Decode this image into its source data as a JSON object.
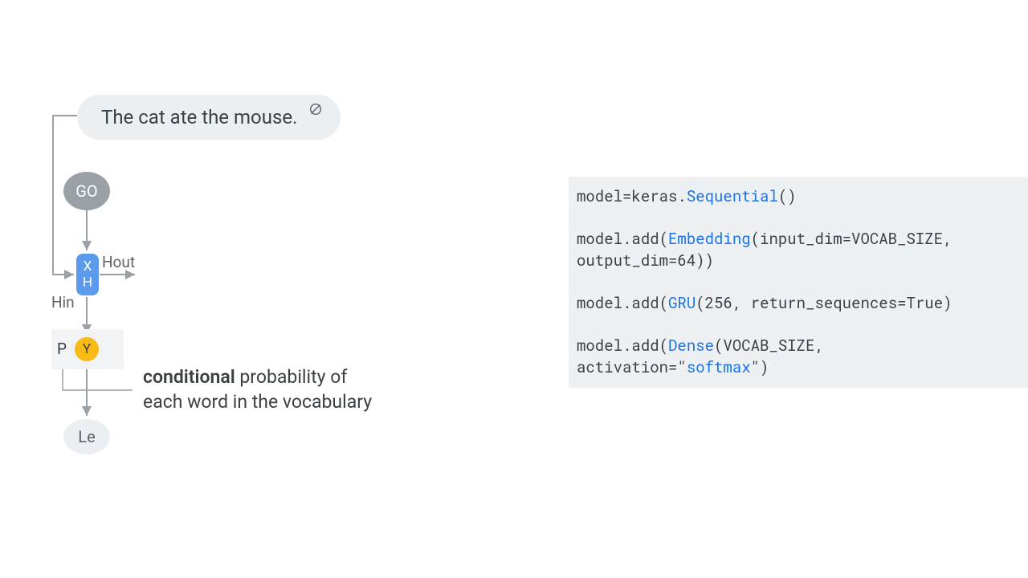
{
  "diagram": {
    "input_text": "The cat ate the mouse.",
    "go_label": "GO",
    "x_label": "X",
    "h_label": "H",
    "y_label": "Y",
    "p_label": "P",
    "le_label": "Le",
    "hin_label": "Hin",
    "hout_label": "Hout",
    "desc_strong": "conditional",
    "desc_rest": " probability of\neach word in the vocabulary"
  },
  "code": {
    "line1_pre": "model=keras.",
    "line1_kw": "Sequential",
    "line1_post": "()",
    "line2_pre": "model.add(",
    "line2_kw": "Embedding",
    "line2_post": "(input_dim=VOCAB_SIZE, output_dim=64))",
    "line3_pre": "model.add(",
    "line3_kw": "GRU",
    "line3_post": "(256, return_sequences=True)",
    "line4_pre": "model.add(",
    "line4_kw": "Dense",
    "line4_mid": "(VOCAB_SIZE, activation=\"",
    "line4_str": "softmax",
    "line4_post": "\")"
  }
}
